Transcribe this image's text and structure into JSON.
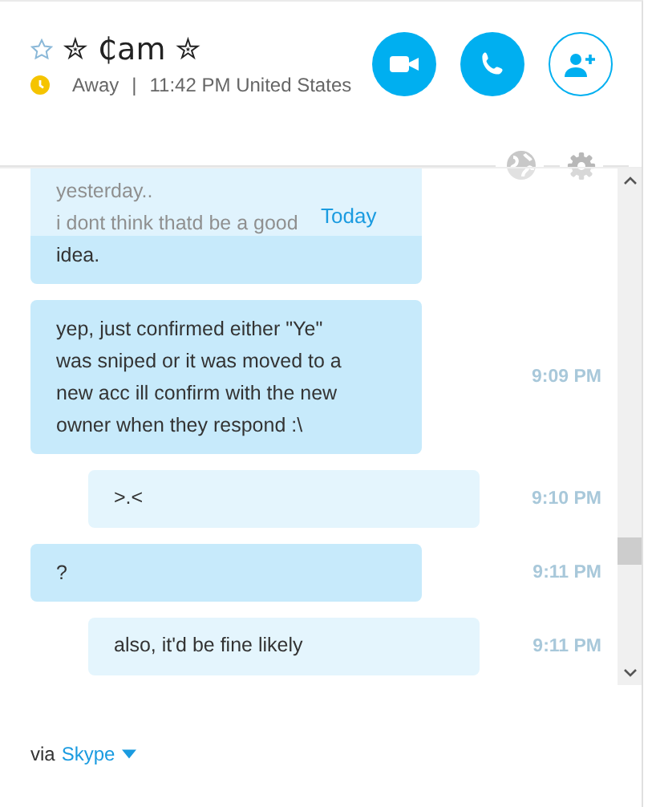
{
  "contact": {
    "name": "✮ ₵am ✮",
    "favorite": false,
    "status": "Away",
    "separator": "|",
    "status_detail": "11:42 PM United States"
  },
  "divider_label": "Today",
  "messages": [
    {
      "outgoing": false,
      "text": "yesterday..\ni dont think thatd be a good\nidea."
    },
    {
      "outgoing": false,
      "text": "yep, just confirmed either \"Ye\"\nwas sniped or it was moved to a\nnew acc ill confirm with the new\nowner when they respond :\\",
      "time": "9:09 PM"
    },
    {
      "outgoing": true,
      "text": ">.<",
      "time": "9:10 PM"
    },
    {
      "outgoing": false,
      "text": "?",
      "time": "9:11 PM"
    },
    {
      "outgoing": true,
      "text": "also, it'd be fine likely",
      "time": "9:11 PM"
    }
  ],
  "footer": {
    "prefix": "via",
    "service": "Skype"
  }
}
